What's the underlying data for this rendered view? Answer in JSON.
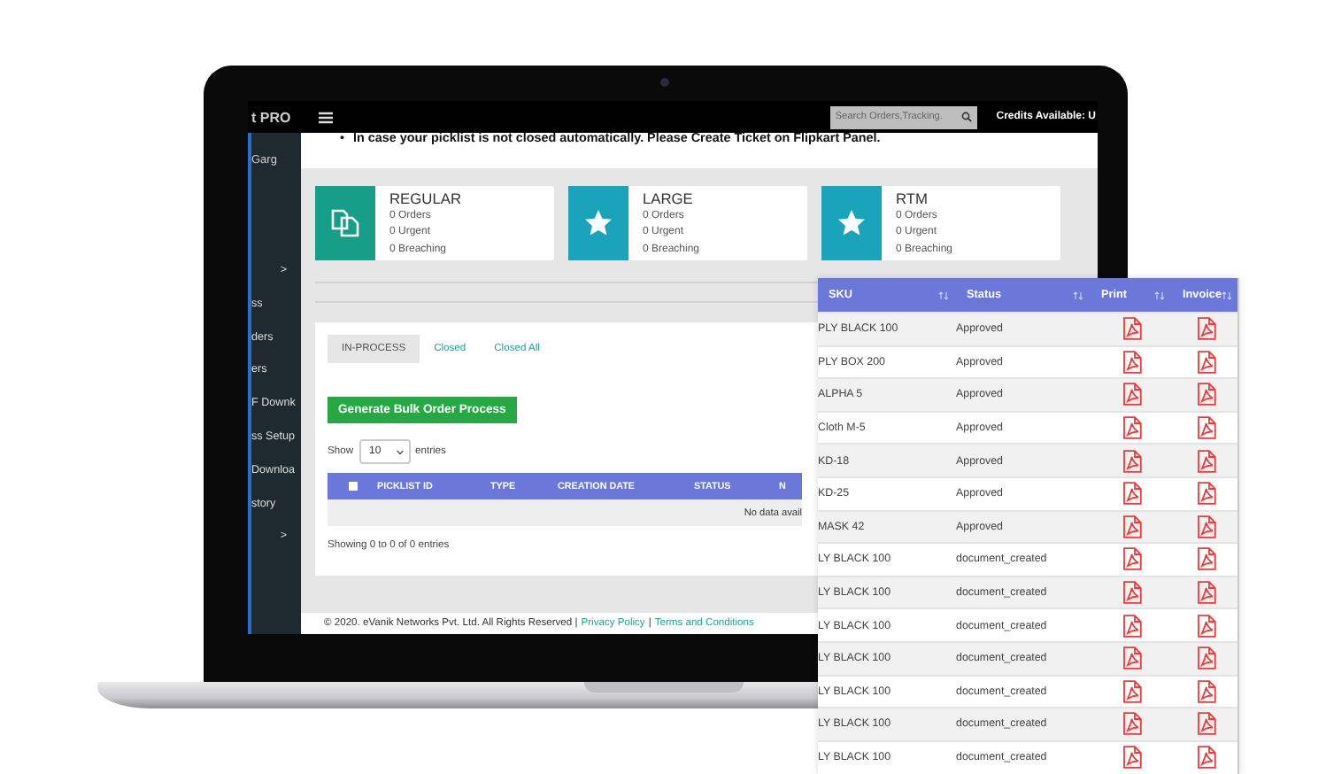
{
  "topbar": {
    "brand": "t PRO",
    "search": {
      "placeholder": "Search Orders,Tracking."
    },
    "credits": "Credits Available: U"
  },
  "sidebar": {
    "user": "Garg",
    "items": [
      {
        "label": ">",
        "kind": "chevron"
      },
      {
        "label": "ss",
        "kind": "link"
      },
      {
        "label": "ders",
        "kind": "link"
      },
      {
        "label": "ers",
        "kind": "link"
      },
      {
        "label": "F Downk",
        "kind": "link"
      },
      {
        "label": "ss Setup",
        "kind": "link"
      },
      {
        "label": "Downloa",
        "kind": "link"
      },
      {
        "label": "story",
        "kind": "link"
      },
      {
        "label": ">",
        "kind": "chevron"
      }
    ]
  },
  "notice_bullet": "•",
  "notice": "In case your picklist is not closed automatically. Please Create Ticket on Flipkart Panel.",
  "cards": [
    {
      "title": "REGULAR",
      "kind": "copy",
      "color": "#179e89",
      "stats": [
        "0 Orders",
        "0 Urgent",
        "0 Breaching"
      ]
    },
    {
      "title": "LARGE",
      "kind": "star",
      "color": "#19a4bc",
      "stats": [
        "0 Orders",
        "0 Urgent",
        "0 Breaching"
      ]
    },
    {
      "title": "RTM",
      "kind": "star",
      "color": "#19a4bc",
      "stats": [
        "0 Orders",
        "0 Urgent",
        "0 Breaching"
      ]
    }
  ],
  "tabs": [
    {
      "label": "IN-PROCESS",
      "selected": true
    },
    {
      "label": "Closed",
      "selected": false
    },
    {
      "label": "Closed All",
      "selected": false
    }
  ],
  "bulk_button": "Generate Bulk Order Process",
  "length": {
    "show": "Show",
    "value": "10",
    "entries": "entries"
  },
  "picklist_table": {
    "select_all": {
      "checked": false
    },
    "columns": [
      "PICKLIST ID",
      "TYPE",
      "CREATION DATE",
      "STATUS",
      "N"
    ],
    "empty": "No data avail"
  },
  "info": "Showing 0 to 0 of 0 entries",
  "footer": [
    {
      "kind": "text",
      "text": "© 2020. eVanik Networks Pvt. Ltd. All Rights Reserved |"
    },
    {
      "kind": "link",
      "text": "Privacy Policy"
    },
    {
      "kind": "text",
      "text": "|"
    },
    {
      "kind": "link",
      "text": "Terms and Conditions"
    }
  ],
  "sku_table": {
    "columns": [
      "SKU",
      "Status",
      "Print",
      "Invoice"
    ],
    "rows": [
      {
        "sku": "PLY BLACK 100",
        "status": "Approved"
      },
      {
        "sku": "PLY BOX 200",
        "status": "Approved"
      },
      {
        "sku": "ALPHA 5",
        "status": "Approved"
      },
      {
        "sku": "Cloth M-5",
        "status": "Approved"
      },
      {
        "sku": "KD-18",
        "status": "Approved"
      },
      {
        "sku": "KD-25",
        "status": "Approved"
      },
      {
        "sku": "MASK 42",
        "status": "Approved"
      },
      {
        "sku": "LY BLACK 100",
        "status": "document_created"
      },
      {
        "sku": "LY BLACK 100",
        "status": "document_created"
      },
      {
        "sku": "LY BLACK 100",
        "status": "document_created"
      },
      {
        "sku": "LY BLACK 100",
        "status": "document_created"
      },
      {
        "sku": "LY BLACK 100",
        "status": "document_created"
      },
      {
        "sku": "LY BLACK 100",
        "status": "document_created"
      },
      {
        "sku": "LY BLACK 100",
        "status": "document_created"
      }
    ]
  }
}
